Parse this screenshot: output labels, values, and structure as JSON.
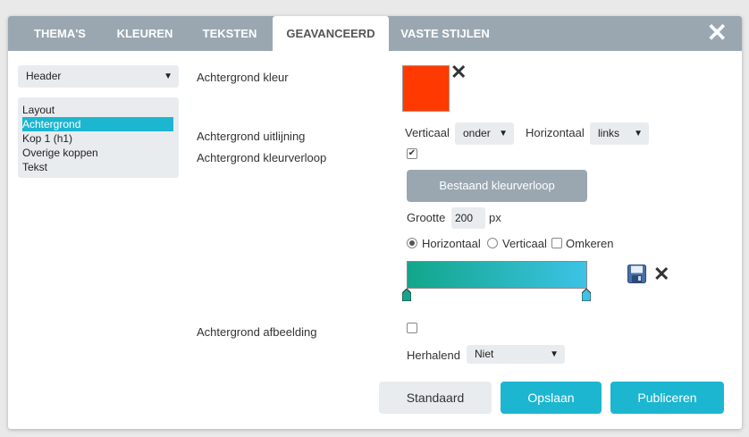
{
  "tabs": [
    {
      "label": "THEMA'S"
    },
    {
      "label": "KLEUREN"
    },
    {
      "label": "TEKSTEN"
    },
    {
      "label": "GEAVANCEERD"
    },
    {
      "label": "VASTE STIJLEN"
    }
  ],
  "active_tab": "GEAVANCEERD",
  "sidebar": {
    "section_select": "Header",
    "items": [
      {
        "label": "Layout"
      },
      {
        "label": "Achtergrond"
      },
      {
        "label": "Kop 1 (h1)"
      },
      {
        "label": "Overige koppen"
      },
      {
        "label": "Tekst"
      }
    ],
    "active_item": "Achtergrond"
  },
  "form": {
    "bg_color_label": "Achtergrond kleur",
    "bg_color_value": "#ff3a00",
    "align_label": "Achtergrond uitlijning",
    "vertical_label": "Verticaal",
    "vertical_value": "onder",
    "horizontal_label": "Horizontaal",
    "horizontal_value": "links",
    "gradient_label": "Achtergrond kleurverloop",
    "gradient_checked": true,
    "existing_gradient_button": "Bestaand kleurverloop",
    "size_label": "Grootte",
    "size_value": "200",
    "size_unit": "px",
    "direction_horizontal": "Horizontaal",
    "direction_vertical": "Verticaal",
    "reverse_label": "Omkeren",
    "direction_selected": "Horizontaal",
    "gradient_start": "#12a68a",
    "gradient_end": "#3cc3e6",
    "image_label": "Achtergrond afbeelding",
    "image_checked": false,
    "repeat_label": "Herhalend",
    "repeat_value": "Niet"
  },
  "footer": {
    "default_button": "Standaard",
    "save_button": "Opslaan",
    "publish_button": "Publiceren"
  }
}
